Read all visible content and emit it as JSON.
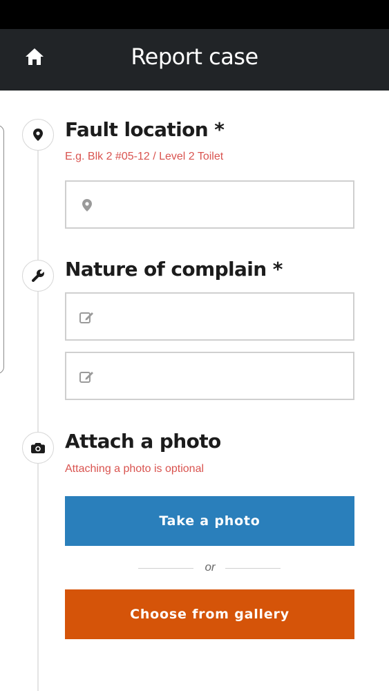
{
  "header": {
    "title": "Report case",
    "home_icon": "home-icon"
  },
  "sections": {
    "location": {
      "icon": "map-marker-icon",
      "title": "Fault location *",
      "hint": "E.g. Blk 2 #05-12 / Level 2 Toilet",
      "field": {
        "value": "",
        "placeholder": "",
        "icon": "map-marker-icon"
      }
    },
    "complaint": {
      "icon": "wrench-icon",
      "title": "Nature of complain *",
      "field1": {
        "value": "",
        "placeholder": "",
        "icon": "edit-icon"
      },
      "field2": {
        "value": "",
        "placeholder": "",
        "icon": "edit-icon"
      }
    },
    "photo": {
      "icon": "camera-icon",
      "title": "Attach a photo",
      "hint": "Attaching a photo is optional",
      "take_photo_label": "Take a photo",
      "divider_text": "or",
      "gallery_label": "Choose from gallery"
    }
  },
  "colors": {
    "header_bg": "#212427",
    "hint_red": "#d9534f",
    "take_photo_blue": "#2a7fbb",
    "gallery_orange": "#d55409"
  }
}
